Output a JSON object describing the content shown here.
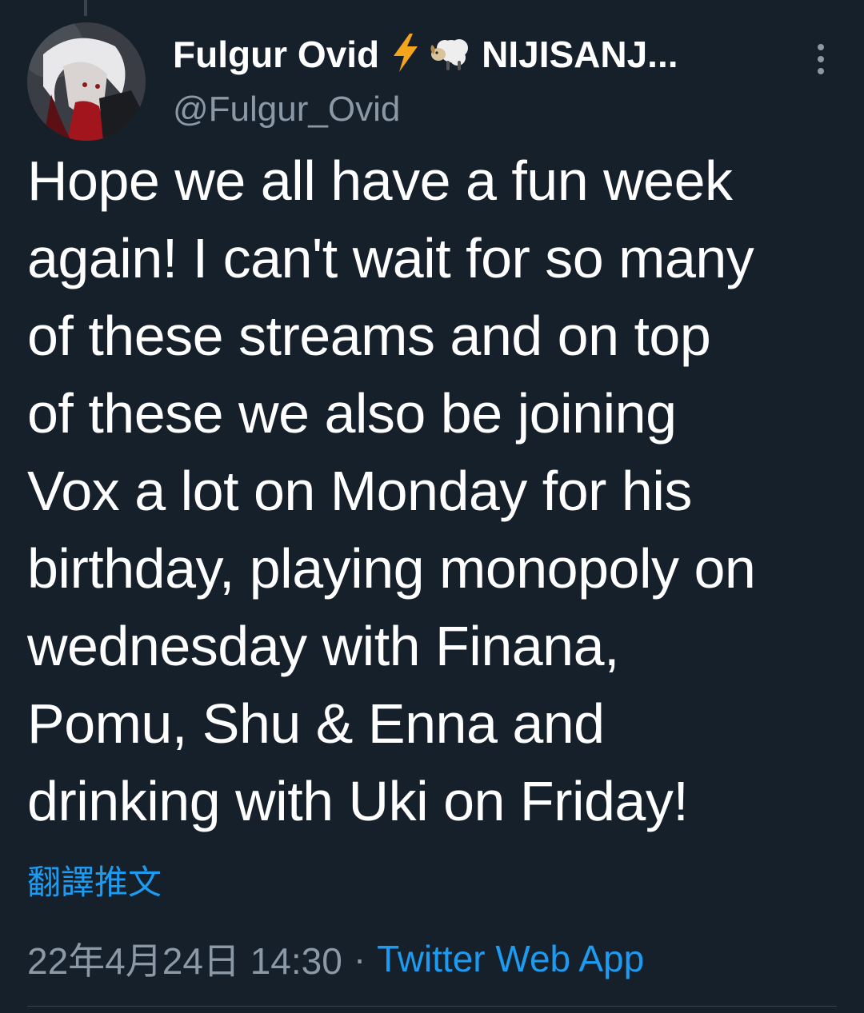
{
  "tweet": {
    "author": {
      "display_name": "Fulgur Ovid",
      "name_suffix": "NIJISANJ...",
      "handle": "@Fulgur_Ovid",
      "emojis": [
        "lightning-icon",
        "sheep-icon"
      ]
    },
    "text_lines": [
      "Hope we all have a fun week",
      "again! I can't wait for so many",
      "of these streams and on top",
      "of these we also be joining",
      "Vox a lot on Monday for his",
      "birthday, playing monopoly on",
      "wednesday with Finana,",
      "Pomu, Shu & Enna and",
      "drinking with Uki on Friday!"
    ],
    "translate_label": "翻譯推文",
    "timestamp": "22年4月24日 14:30",
    "separator": "·",
    "source": "Twitter Web App"
  },
  "colors": {
    "background": "#15202b",
    "text_primary": "#ffffff",
    "text_secondary": "#8b98a5",
    "link": "#1d9bf0",
    "divider": "#38444d"
  }
}
